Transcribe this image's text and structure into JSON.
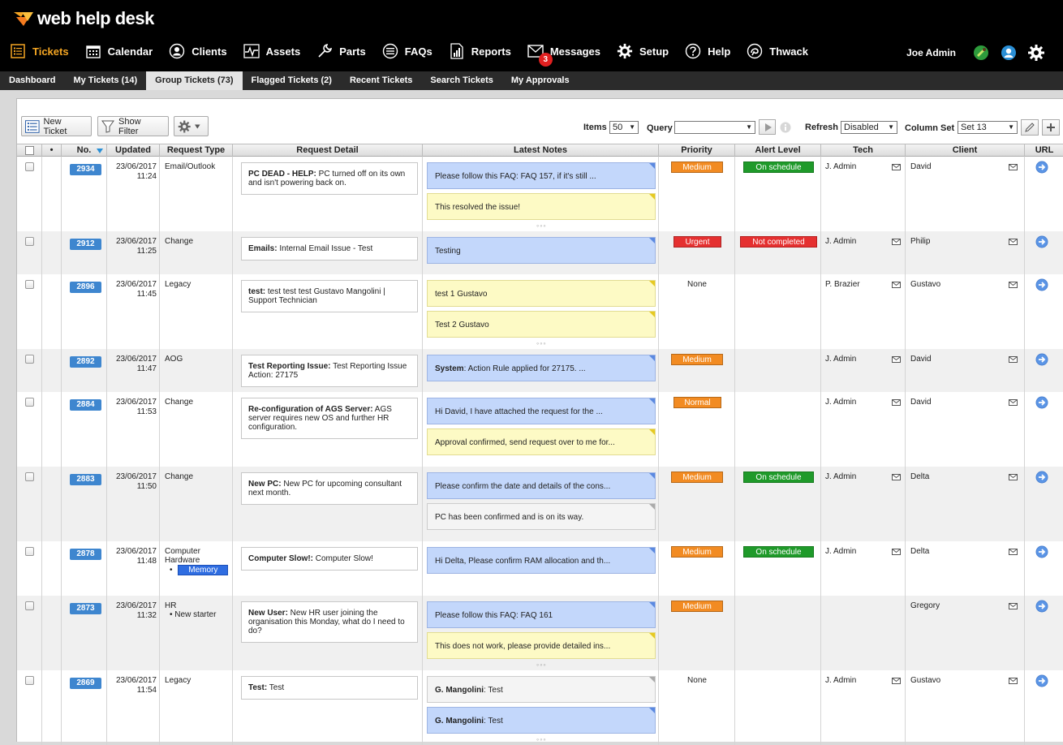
{
  "brand": {
    "name": "web help desk",
    "accent": "#f5a623"
  },
  "nav": [
    {
      "label": "Tickets",
      "icon": "list-icon",
      "active": true
    },
    {
      "label": "Calendar",
      "icon": "calendar-icon"
    },
    {
      "label": "Clients",
      "icon": "user-icon"
    },
    {
      "label": "Assets",
      "icon": "pulse-icon"
    },
    {
      "label": "Parts",
      "icon": "wrench-icon"
    },
    {
      "label": "FAQs",
      "icon": "list-circle-icon"
    },
    {
      "label": "Reports",
      "icon": "report-icon"
    },
    {
      "label": "Messages",
      "icon": "envelope-icon",
      "badge": "3"
    },
    {
      "label": "Setup",
      "icon": "gear-icon"
    },
    {
      "label": "Help",
      "icon": "question-icon"
    },
    {
      "label": "Thwack",
      "icon": "thwack-icon"
    }
  ],
  "user": {
    "name": "Joe Admin"
  },
  "subtabs": [
    {
      "label": "Dashboard"
    },
    {
      "label": "My Tickets (14)"
    },
    {
      "label": "Group Tickets (73)",
      "active": true
    },
    {
      "label": "Flagged Tickets (2)"
    },
    {
      "label": "Recent Tickets"
    },
    {
      "label": "Search Tickets"
    },
    {
      "label": "My Approvals"
    }
  ],
  "toolbar": {
    "new_ticket": "New Ticket",
    "show_filter": "Show Filter",
    "items_label": "Items",
    "items_value": "50",
    "query_label": "Query",
    "query_value": "",
    "refresh_label": "Refresh",
    "refresh_value": "Disabled",
    "column_set_label": "Column Set",
    "column_set_value": "Set 13"
  },
  "columns": {
    "bullet": "•",
    "no": "No.",
    "updated": "Updated",
    "request_type": "Request Type",
    "request_detail": "Request Detail",
    "latest_notes": "Latest Notes",
    "priority": "Priority",
    "alert_level": "Alert Level",
    "tech": "Tech",
    "client": "Client",
    "url": "URL"
  },
  "tickets": [
    {
      "no": "2934",
      "date": "23/06/2017",
      "time": "11:24",
      "type": "Email/Outlook",
      "subtype": "",
      "tag": "",
      "subject": "PC DEAD - HELP:",
      "detail": " PC turned off on its own and isn't powering back on.",
      "notes": [
        {
          "text": "Please follow this FAQ: FAQ 157, if it's still ...",
          "color": "blue",
          "author": ""
        },
        {
          "text": "This resolved the issue!",
          "color": "yellow",
          "author": ""
        }
      ],
      "more": true,
      "priority": "Medium",
      "priority_class": "medium",
      "alert": "On schedule",
      "alert_class": "ok",
      "tech": "J. Admin",
      "client": "David"
    },
    {
      "no": "2912",
      "date": "23/06/2017",
      "time": "11:25",
      "type": "Change",
      "subtype": "",
      "tag": "",
      "subject": "Emails:",
      "detail": " Internal Email Issue - Test",
      "notes": [
        {
          "text": "Testing",
          "color": "blue",
          "author": ""
        }
      ],
      "more": false,
      "priority": "Urgent",
      "priority_class": "urgent",
      "alert": "Not completed",
      "alert_class": "bad",
      "tech": "J. Admin",
      "client": "Philip"
    },
    {
      "no": "2896",
      "date": "23/06/2017",
      "time": "11:45",
      "type": "Legacy",
      "subtype": "",
      "tag": "",
      "subject": "test:",
      "detail": " test test test Gustavo Mangolini | Support Technician",
      "notes": [
        {
          "text": "test 1 Gustavo",
          "color": "yellow",
          "author": ""
        },
        {
          "text": "Test 2 Gustavo",
          "color": "yellow",
          "author": ""
        }
      ],
      "more": true,
      "priority": "None",
      "priority_class": "none",
      "alert": "",
      "alert_class": "",
      "tech": "P. Brazier",
      "client": "Gustavo"
    },
    {
      "no": "2892",
      "date": "23/06/2017",
      "time": "11:47",
      "type": "AOG",
      "subtype": "",
      "tag": "",
      "subject": "Test Reporting Issue:",
      "detail": " Test Reporting Issue Action: 27175",
      "notes": [
        {
          "text": ": Action Rule applied for 27175. ...",
          "color": "blue",
          "author": "System"
        }
      ],
      "more": false,
      "priority": "Medium",
      "priority_class": "medium",
      "alert": "",
      "alert_class": "",
      "tech": "J. Admin",
      "client": "David"
    },
    {
      "no": "2884",
      "date": "23/06/2017",
      "time": "11:53",
      "type": "Change",
      "subtype": "",
      "tag": "",
      "subject": "Re-configuration of AGS Server:",
      "detail": " AGS server requires new OS and further HR configuration.",
      "notes": [
        {
          "text": "Hi David, I have attached the request for the ...",
          "color": "blue",
          "author": ""
        },
        {
          "text": "Approval confirmed, send request over to me for...",
          "color": "yellow",
          "author": ""
        }
      ],
      "more": false,
      "priority": "Normal",
      "priority_class": "normal",
      "alert": "",
      "alert_class": "",
      "tech": "J. Admin",
      "client": "David"
    },
    {
      "no": "2883",
      "date": "23/06/2017",
      "time": "11:50",
      "type": "Change",
      "subtype": "",
      "tag": "",
      "subject": "New PC:",
      "detail": " New PC for upcoming consultant next month.",
      "notes": [
        {
          "text": "Please confirm the date and details of the cons...",
          "color": "blue",
          "author": ""
        },
        {
          "text": "PC has been confirmed and is on its way.",
          "color": "grey",
          "author": ""
        }
      ],
      "more": false,
      "priority": "Medium",
      "priority_class": "medium",
      "alert": "On schedule",
      "alert_class": "ok",
      "tech": "J. Admin",
      "client": "Delta"
    },
    {
      "no": "2878",
      "date": "23/06/2017",
      "time": "11:48",
      "type": "Computer Hardware",
      "subtype": "",
      "tag": "Memory",
      "subject": "Computer Slow!:",
      "detail": " Computer Slow!",
      "notes": [
        {
          "text": "Hi Delta, Please confirm RAM allocation and th...",
          "color": "blue",
          "author": ""
        }
      ],
      "more": false,
      "priority": "Medium",
      "priority_class": "medium",
      "alert": "On schedule",
      "alert_class": "ok",
      "tech": "J. Admin",
      "client": "Delta"
    },
    {
      "no": "2873",
      "date": "23/06/2017",
      "time": "11:32",
      "type": "HR",
      "subtype": "New starter",
      "tag": "",
      "subject": "New User:",
      "detail": " New HR user joining the organisation this Monday, what do I need to do?",
      "notes": [
        {
          "text": "Please follow this FAQ: FAQ 161",
          "color": "blue",
          "author": ""
        },
        {
          "text": "This does not work, please provide detailed ins...",
          "color": "yellow",
          "author": ""
        }
      ],
      "more": true,
      "priority": "Medium",
      "priority_class": "medium",
      "alert": "",
      "alert_class": "",
      "tech": "",
      "client": "Gregory"
    },
    {
      "no": "2869",
      "date": "23/06/2017",
      "time": "11:54",
      "type": "Legacy",
      "subtype": "",
      "tag": "",
      "subject": "Test:",
      "detail": " Test",
      "notes": [
        {
          "text": ": Test",
          "color": "grey",
          "author": "G. Mangolini"
        },
        {
          "text": ": Test",
          "color": "blue",
          "author": "G. Mangolini"
        }
      ],
      "more": true,
      "priority": "None",
      "priority_class": "none",
      "alert": "",
      "alert_class": "",
      "tech": "J. Admin",
      "client": "Gustavo"
    }
  ]
}
